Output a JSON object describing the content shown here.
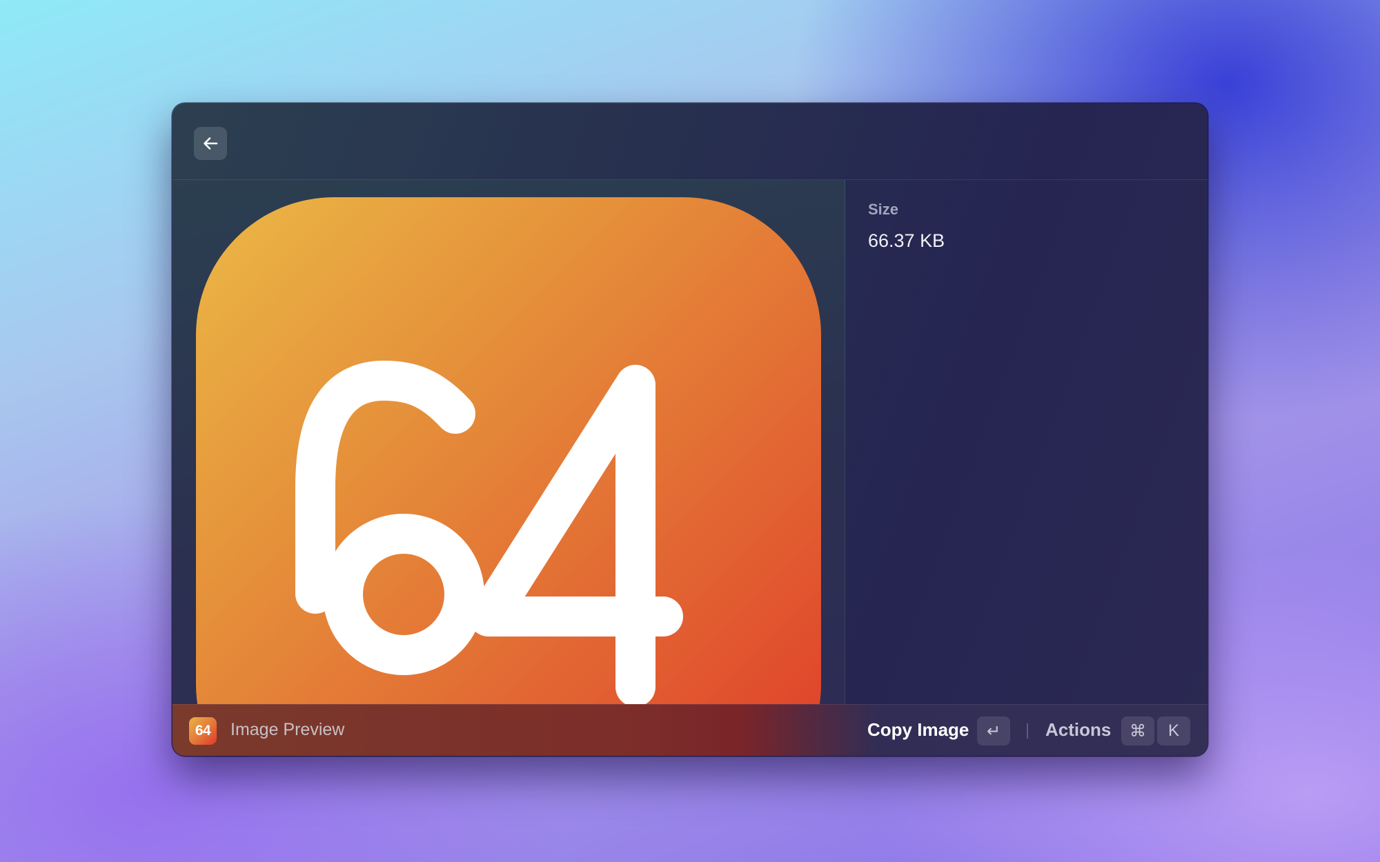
{
  "window": {
    "back_icon": "arrow-left-icon"
  },
  "preview": {
    "app_icon_text": "64",
    "icon_colors": [
      "#ebb846",
      "#e58f3a",
      "#e26232",
      "#de3a28"
    ]
  },
  "metadata": {
    "size_label": "Size",
    "size_value": "66.37 KB"
  },
  "bottombar": {
    "app_icon_text": "64",
    "title": "Image Preview",
    "primary_action": "Copy Image",
    "primary_shortcut": "↵",
    "actions_label": "Actions",
    "actions_shortcut_modifier": "⌘",
    "actions_shortcut_key": "K"
  }
}
